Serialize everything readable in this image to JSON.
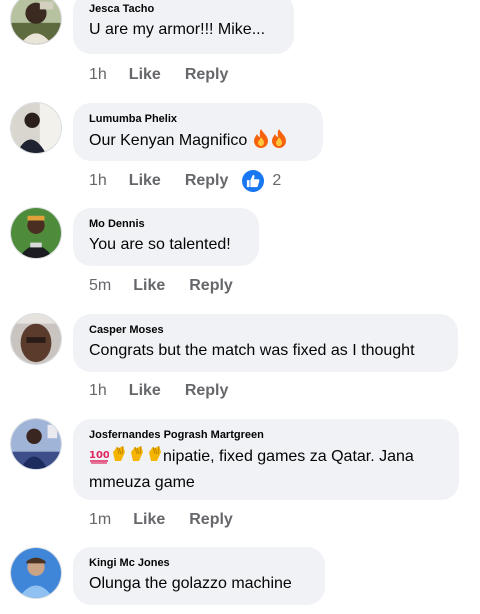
{
  "comments": [
    {
      "author": "Jesca Tacho",
      "text": "U are my  armor!!! Mike...",
      "time": "1h",
      "like": "Like",
      "reply": "Reply"
    },
    {
      "author": "Lumumba Phelix",
      "text": "Our Kenyan Magnifico",
      "time": "1h",
      "like": "Like",
      "reply": "Reply",
      "reaction_count": "2"
    },
    {
      "author": "Mo Dennis",
      "text": "You are so talented!",
      "time": "5m",
      "like": "Like",
      "reply": "Reply"
    },
    {
      "author": "Casper Moses",
      "text": "Congrats but the match was fixed as I thought",
      "time": "1h",
      "like": "Like",
      "reply": "Reply"
    },
    {
      "author": "Josfernandes Pogrash Martgreen",
      "text_line1": "nipatie, fixed games za Qatar. Jana",
      "text_line2": "mmeuza game",
      "time": "1m",
      "like": "Like",
      "reply": "Reply"
    },
    {
      "author": "Kingi Mc Jones",
      "text": "Olunga the golazzo machine"
    }
  ],
  "colors": {
    "bubble": "#f0f2f5",
    "meta": "#65676b",
    "like_badge": "#1877f2"
  }
}
